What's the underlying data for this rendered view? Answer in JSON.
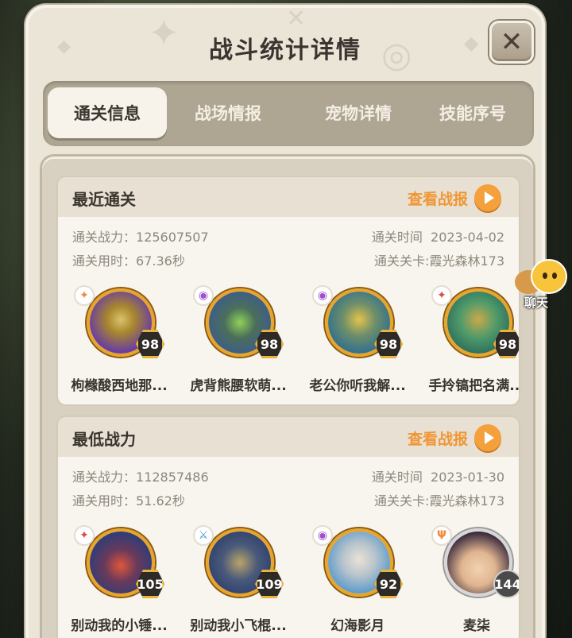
{
  "dialog": {
    "title": "战斗统计详情",
    "close_label": "✕"
  },
  "tabs": [
    {
      "label": "通关信息",
      "active": true
    },
    {
      "label": "战场情报",
      "active": false
    },
    {
      "label": "宠物详情",
      "active": false
    },
    {
      "label": "技能序号",
      "active": false
    }
  ],
  "chat": {
    "label": "聊天"
  },
  "sections": [
    {
      "title": "最近通关",
      "view_label": "查看战报",
      "power_label": "通关战力：",
      "power_value": "125607507",
      "time_label": "通关时间",
      "time_value": "2023-04-02",
      "duration_label": "通关用时：",
      "duration_value": "67.36秒",
      "stage_label": "通关关卡:",
      "stage_value": "霞光森林173",
      "pets": [
        {
          "name": "枸橼酸西地那...",
          "level": "98",
          "icon": "fire-element-icon",
          "colors": [
            "#6a3fa0",
            "#d9c36a"
          ]
        },
        {
          "name": "虎背熊腰软萌...",
          "level": "98",
          "icon": "psychic-element-icon",
          "colors": [
            "#3d5c8a",
            "#8fd05a"
          ]
        },
        {
          "name": "老公你听我解...",
          "level": "98",
          "icon": "psychic-element-icon",
          "colors": [
            "#2f6f8f",
            "#e4c24a"
          ]
        },
        {
          "name": "手拎镐把名满...",
          "level": "98",
          "icon": "fire-element-icon",
          "colors": [
            "#3a8a6a",
            "#c9a94a"
          ]
        }
      ]
    },
    {
      "title": "最低战力",
      "view_label": "查看战报",
      "power_label": "通关战力：",
      "power_value": "112857486",
      "time_label": "通关时间",
      "time_value": "2023-01-30",
      "duration_label": "通关用时：",
      "duration_value": "51.62秒",
      "stage_label": "通关关卡:",
      "stage_value": "霞光森林173",
      "pets": [
        {
          "name": "别动我的小锤...",
          "level": "105",
          "icon": "fire-element-icon",
          "colors": [
            "#2b3d7a",
            "#e0563a"
          ]
        },
        {
          "name": "别动我小飞棍...",
          "level": "109",
          "icon": "sword-element-icon",
          "colors": [
            "#2d3f6e",
            "#b9a36a"
          ]
        },
        {
          "name": "幻海影月",
          "level": "92",
          "icon": "psychic-element-icon",
          "colors": [
            "#5a9ac9",
            "#e9e2d6"
          ]
        },
        {
          "name": "麦柒",
          "level": "144",
          "icon": "trident-element-icon",
          "colors": [
            "#f2d2b2",
            "#3a2a3e"
          ]
        }
      ]
    }
  ]
}
